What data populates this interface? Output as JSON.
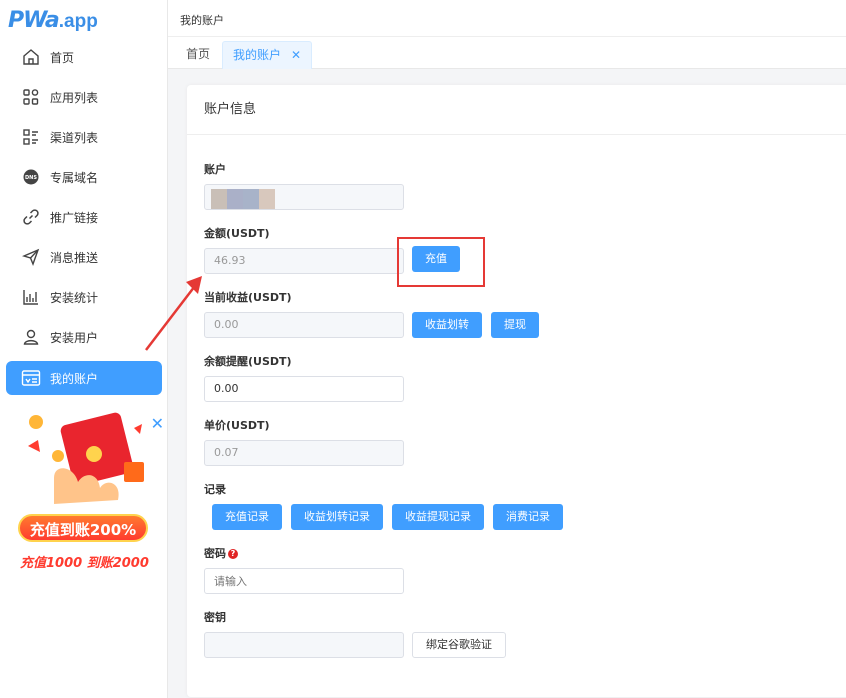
{
  "logo": {
    "main": "PWa",
    "sub": ".app"
  },
  "menu": [
    {
      "label": "首页",
      "icon": "home-icon"
    },
    {
      "label": "应用列表",
      "icon": "apps-icon"
    },
    {
      "label": "渠道列表",
      "icon": "list-icon"
    },
    {
      "label": "专属域名",
      "icon": "dns-icon"
    },
    {
      "label": "推广链接",
      "icon": "link-icon"
    },
    {
      "label": "消息推送",
      "icon": "send-icon"
    },
    {
      "label": "安装统计",
      "icon": "chart-icon"
    },
    {
      "label": "安装用户",
      "icon": "user-icon"
    },
    {
      "label": "我的账户",
      "icon": "wallet-icon"
    }
  ],
  "ad": {
    "title": "充值到账200%",
    "subtitle": "充值1000 到账2000"
  },
  "breadcrumb": "我的账户",
  "tabs": {
    "home": "首页",
    "active": "我的账户"
  },
  "card": {
    "title": "账户信息",
    "account_label": "账户",
    "amount_label": "金额(USDT)",
    "amount_value": "46.93",
    "recharge_btn": "充值",
    "income_label": "当前收益(USDT)",
    "income_value": "0.00",
    "transfer_btn": "收益划转",
    "withdraw_btn": "提现",
    "reminder_label": "余额提醒(USDT)",
    "reminder_value": "0.00",
    "price_label": "单价(USDT)",
    "price_value": "0.07",
    "records_label": "记录",
    "records": [
      "充值记录",
      "收益划转记录",
      "收益提现记录",
      "消费记录"
    ],
    "password_label": "密码",
    "password_help": "?",
    "password_placeholder": "请输入",
    "secret_label": "密钥",
    "bind_btn": "绑定谷歌验证"
  },
  "colors": {
    "primary": "#409eff",
    "highlight": "#e53935"
  }
}
